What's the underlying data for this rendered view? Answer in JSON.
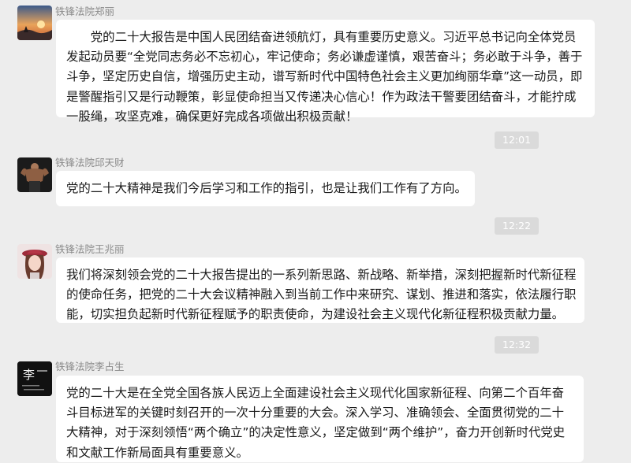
{
  "colors": {
    "background": "#ededed",
    "bubble": "#ffffff",
    "sender": "#8a8a8a",
    "timestamp_bg": "#dadada"
  },
  "messages": [
    {
      "sender": "铁锋法院郑丽",
      "avatar_icon": "sunset-landscape-avatar",
      "text": "　　党的二十大报告是中国人民团结奋进领航灯，具有重要历史意义。习近平总书记向全体党员发起动员要“全党同志务必不忘初心，牢记使命；务必谦虚谨慎，艰苦奋斗；务必敢于斗争，善于斗争，坚定历史自信，增强历史主动，谱写新时代中国特色社会主义更加绚丽华章”这一动员，即是警醒指引又是行动鞭策，彰显使命担当又传递决心信心！作为政法干警要团结奋斗，才能拧成一股绳，攻坚克难，确保更好完成各项做出积极贡献！"
    },
    {
      "time": "12:01"
    },
    {
      "sender": "铁锋法院邱天财",
      "avatar_icon": "muscle-man-avatar",
      "text": "党的二十大精神是我们今后学习和工作的指引，也是让我们工作有了方向。"
    },
    {
      "time": "12:22"
    },
    {
      "sender": "铁锋法院王兆丽",
      "avatar_icon": "girl-red-hat-avatar",
      "text": "我们将深刻领会党的二十大报告提出的一系列新思路、新战略、新举措，深刻把握新时代新征程的使命任务，把党的二十大会议精神融入到当前工作中来研究、谋划、推进和落实，依法履行职能，切实担负起新时代新征程赋予的职责使命，为建设社会主义现代化新征程积极贡献力量。"
    },
    {
      "time": "12:32"
    },
    {
      "sender": "铁锋法院李占生",
      "avatar_icon": "calligraphy-text-avatar",
      "avatar_text": "李",
      "text": "党的二十大是在全党全国各族人民迈上全面建设社会主义现代化国家新征程、向第二个百年奋斗目标进军的关键时刻召开的一次十分重要的大会。深入学习、准确领会、全面贯彻党的二十大精神，对于深刻领悟“两个确立”的决定性意义，坚定做到“两个维护”，奋力开创新时代党史和文献工作新局面具有重要意义。"
    }
  ]
}
